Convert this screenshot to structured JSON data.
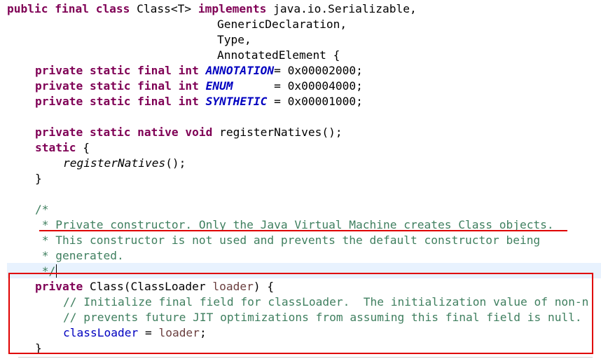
{
  "code": {
    "l1": {
      "kw": "public final class",
      "rest": " Class<T> ",
      "kw2": "implements",
      "rest2": " java.io.Serializable,"
    },
    "l2": "GenericDeclaration,",
    "l3": "Type,",
    "l4": "AnnotatedElement {",
    "l5": {
      "kw": "private static final int",
      "name": "ANNOTATION",
      "rest": "= 0x00002000;"
    },
    "l6": {
      "kw": "private static final int",
      "name": "ENUM",
      "rest": "      = 0x00004000;"
    },
    "l7": {
      "kw": "private static final int",
      "name": "SYNTHETIC",
      "rest": " = 0x00001000;"
    },
    "l9": {
      "kw": "private static native void",
      "rest": " registerNatives();"
    },
    "l10": {
      "kw": "static",
      "rest": " {"
    },
    "l11": {
      "call": "registerNatives",
      "rest": "();"
    },
    "l12": "}",
    "l14": "/*",
    "l15": " * Private constructor. Only the Java Virtual Machine creates Class objects.",
    "l16": " * This constructor is not used and prevents the default constructor being",
    "l17": " * generated.",
    "l18": " */",
    "l19": {
      "kw": "private",
      "rest": " Class(ClassLoader ",
      "param": "loader",
      "rest2": ") {"
    },
    "l20": "// Initialize final field for classLoader.  The initialization value of non-n",
    "l21": "// prevents future JIT optimizations from assuming this final field is null.",
    "l22": {
      "field": "classLoader",
      "rest": " = ",
      "param": "loader",
      "rest2": ";"
    },
    "l23": "}"
  },
  "colors": {
    "keyword": "#7f0055",
    "constant": "#0000c0",
    "comment": "#3f7f5f",
    "highlight_box": "#e00000"
  }
}
